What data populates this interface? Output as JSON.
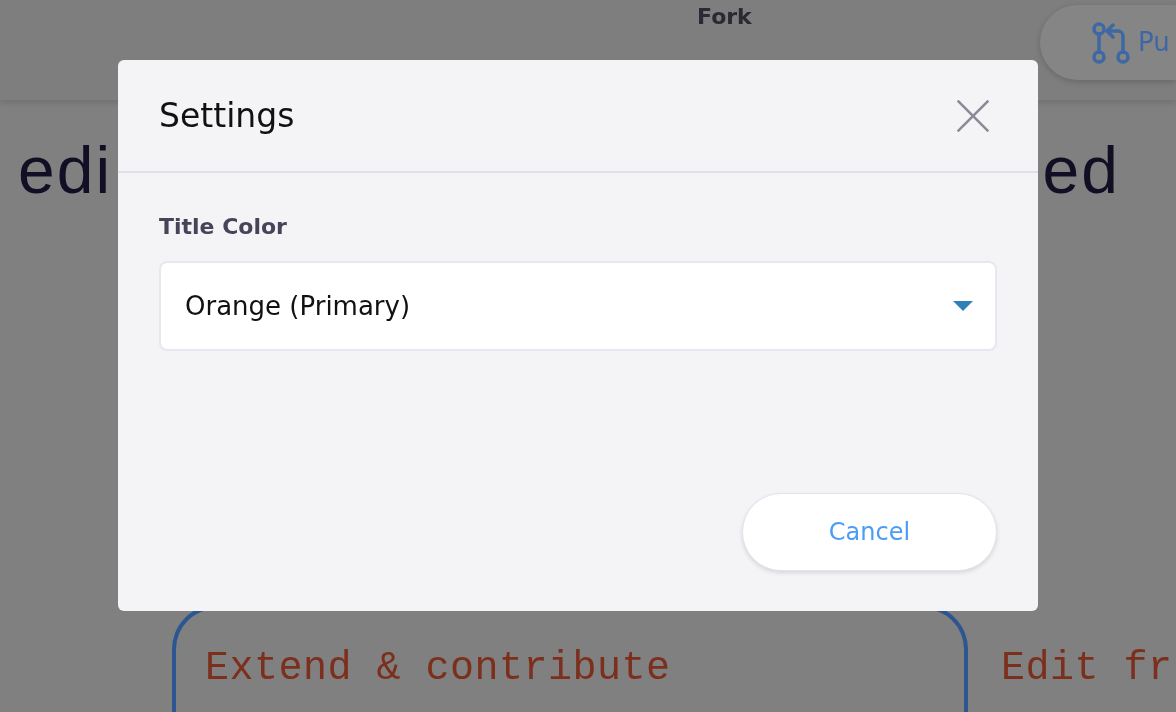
{
  "page": {
    "header": {
      "fork_label": "Fork",
      "pull_request_button": "Pu"
    },
    "hero_heading": {
      "left": "edi",
      "right": "ed"
    },
    "cards": [
      {
        "title": "Extend & contribute",
        "selected": true
      },
      {
        "title": "Edit fr",
        "selected": false
      }
    ]
  },
  "dialog": {
    "title": "Settings",
    "fields": [
      {
        "label": "Title Color",
        "kind": "select",
        "value": "Orange (Primary)"
      }
    ],
    "buttons": [
      {
        "label": "Cancel"
      }
    ]
  }
}
